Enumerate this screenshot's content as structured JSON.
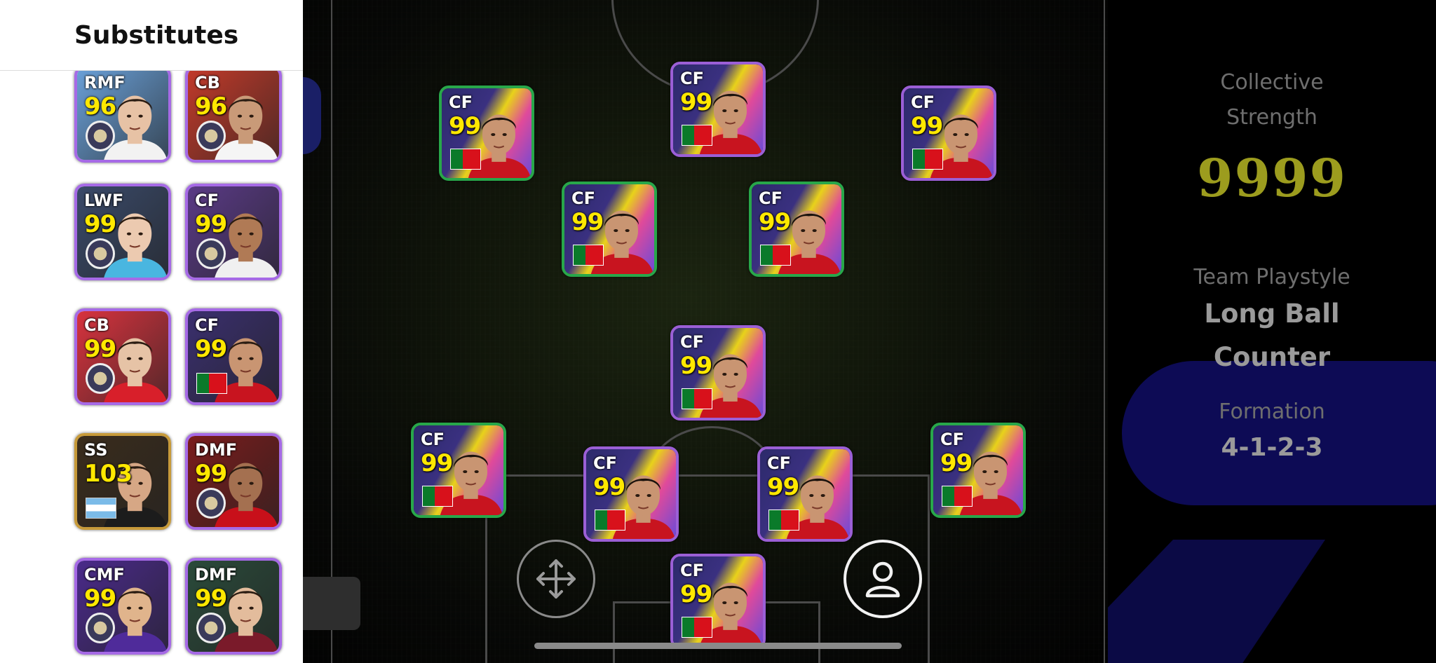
{
  "substitutes": {
    "title": "Substitutes",
    "cards": [
      {
        "position": "RMF",
        "rating": "96",
        "badge": "club-badge-icon",
        "bg": "#6aa0d8",
        "skin": "#e7c2a5",
        "shirt": "#f2f2f2"
      },
      {
        "position": "CB",
        "rating": "96",
        "badge": "club-badge-icon",
        "bg": "#c23a2a",
        "skin": "#c99a78",
        "shirt": "#f5f5f5"
      },
      {
        "position": "LWF",
        "rating": "99",
        "badge": "club-badge-icon",
        "bg": "#3a4a6a",
        "skin": "#eccab0",
        "shirt": "#49b6e0"
      },
      {
        "position": "CF",
        "rating": "99",
        "badge": "club-badge-icon",
        "bg": "#5a3a86",
        "skin": "#b07a55",
        "shirt": "#f0f0f0"
      },
      {
        "position": "CB",
        "rating": "99",
        "badge": "club-badge-icon",
        "bg": "#d8333e",
        "skin": "#e6c3a6",
        "shirt": "#d81f2a"
      },
      {
        "position": "CF",
        "rating": "99",
        "badge": "portugal-flag-icon",
        "bg": "#3a2f6e",
        "skin": "#c99572",
        "shirt": "#c8141f"
      },
      {
        "position": "SS",
        "rating": "103",
        "badge": "argentina-flag-icon",
        "bg": "#3a2c1c",
        "skin": "#d6a785",
        "shirt": "#1c1c1c"
      },
      {
        "position": "DMF",
        "rating": "99",
        "badge": "club-badge-icon",
        "bg": "#7a1c1c",
        "skin": "#a47050",
        "shirt": "#c8101a"
      },
      {
        "position": "CMF",
        "rating": "99",
        "badge": "club-badge-icon",
        "bg": "#4a2a8a",
        "skin": "#e0b48c",
        "shirt": "#4f2b9a"
      },
      {
        "position": "DMF",
        "rating": "99",
        "badge": "club-badge-icon",
        "bg": "#2a4a3a",
        "skin": "#e3bc9c",
        "shirt": "#7a1a2a"
      }
    ]
  },
  "pitch": {
    "players": [
      {
        "position": "CF",
        "rating": "99"
      },
      {
        "position": "CF",
        "rating": "99"
      },
      {
        "position": "CF",
        "rating": "99"
      },
      {
        "position": "CF",
        "rating": "99"
      },
      {
        "position": "CF",
        "rating": "99"
      },
      {
        "position": "CF",
        "rating": "99"
      },
      {
        "position": "CF",
        "rating": "99"
      },
      {
        "position": "CF",
        "rating": "99"
      },
      {
        "position": "CF",
        "rating": "99"
      },
      {
        "position": "CF",
        "rating": "99"
      },
      {
        "position": "CF",
        "rating": "99"
      }
    ],
    "badge_icon": "portugal-flag-icon",
    "move_icon": "move-arrows-icon",
    "person_icon": "person-icon"
  },
  "info": {
    "collective_label_1": "Collective",
    "collective_label_2": "Strength",
    "collective_value": "9999",
    "playstyle_label": "Team Playstyle",
    "playstyle_value_1": "Long Ball",
    "playstyle_value_2": "Counter",
    "formation_label": "Formation",
    "formation_value": "4-1-2-3"
  },
  "colors": {
    "rating_yellow": "#ffe800",
    "strength_olive": "#9c9c1e",
    "card_border_purple": "#9b5fd6",
    "card_border_green": "#28a74a",
    "info_pill_blue": "#0d0b55"
  }
}
